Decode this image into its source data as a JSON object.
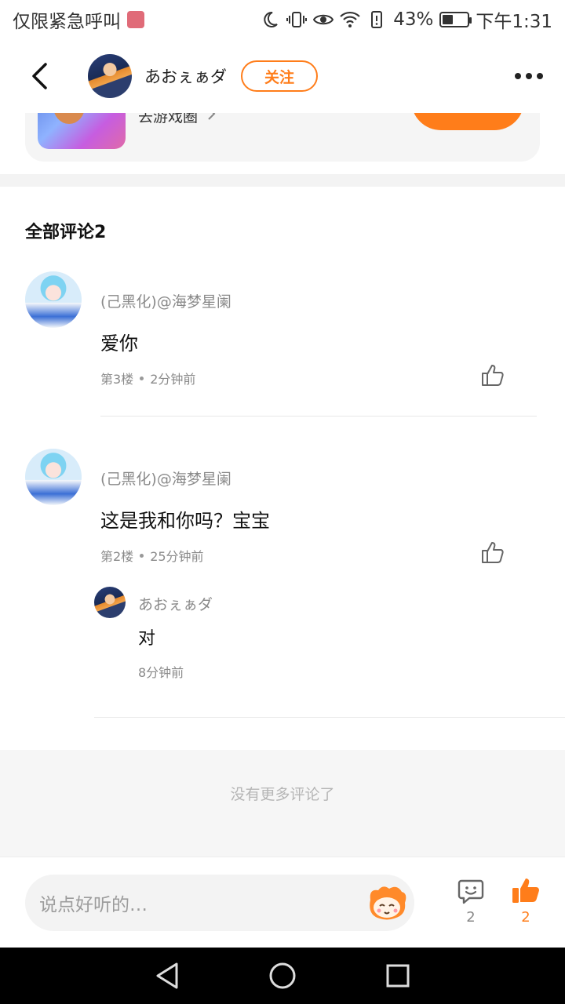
{
  "status_bar": {
    "carrier_text": "仅限紧急呼叫",
    "battery_percent": "43%",
    "battery_level": 0.43,
    "time": "下午1:31",
    "icons": [
      "sim-icon",
      "moon-icon",
      "vibrate-icon",
      "eye-icon",
      "wifi-icon",
      "battery-alert-icon",
      "battery-icon"
    ]
  },
  "header": {
    "author_name": "あおぇぁダ",
    "follow_label": "关注",
    "icons": [
      "back-arrow-icon",
      "more-dots-icon"
    ]
  },
  "game_card": {
    "link_text": "去游戏圈",
    "icon": "chevron-right-icon"
  },
  "comments_section": {
    "title": "全部评论2",
    "comments": [
      {
        "author": "(己黑化)@海梦星阑",
        "text": "爱你",
        "floor": "第3楼",
        "time": "2分钟前"
      },
      {
        "author": "(己黑化)@海梦星阑",
        "text": "这是我和你吗？宝宝",
        "floor": "第2楼",
        "time": "25分钟前",
        "reply": {
          "author": "あおぇぁダ",
          "text": "对",
          "time": "8分钟前"
        }
      }
    ],
    "no_more_text": "没有更多评论了"
  },
  "input_bar": {
    "placeholder": "说点好听的…",
    "comment_count": "2",
    "like_count": "2",
    "accent_color": "#ff7d1a",
    "icons": [
      "mascot-icon",
      "comment-bubble-icon",
      "thumbs-up-filled-icon"
    ]
  },
  "nav_bar": {
    "icons": [
      "nav-back-icon",
      "nav-home-icon",
      "nav-recents-icon"
    ]
  }
}
